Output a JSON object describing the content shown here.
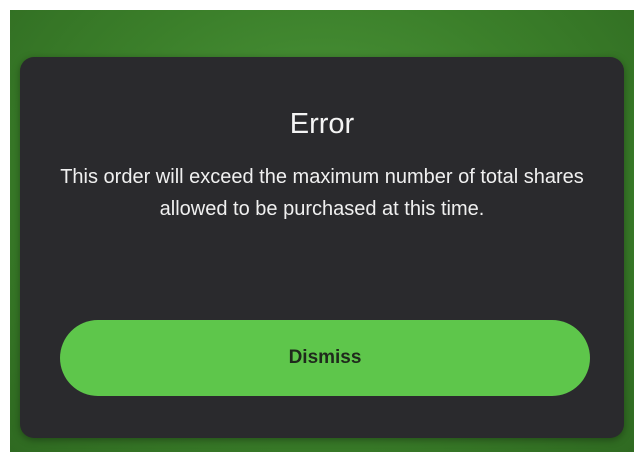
{
  "dialog": {
    "title": "Error",
    "message": "This order will exceed the maximum number of total shares allowed to be purchased at this time.",
    "dismiss_label": "Dismiss"
  },
  "colors": {
    "background": "#3b7f2a",
    "dialog_background": "#2a2a2d",
    "button_background": "#5ec64b",
    "button_text": "#1f2a1c"
  }
}
